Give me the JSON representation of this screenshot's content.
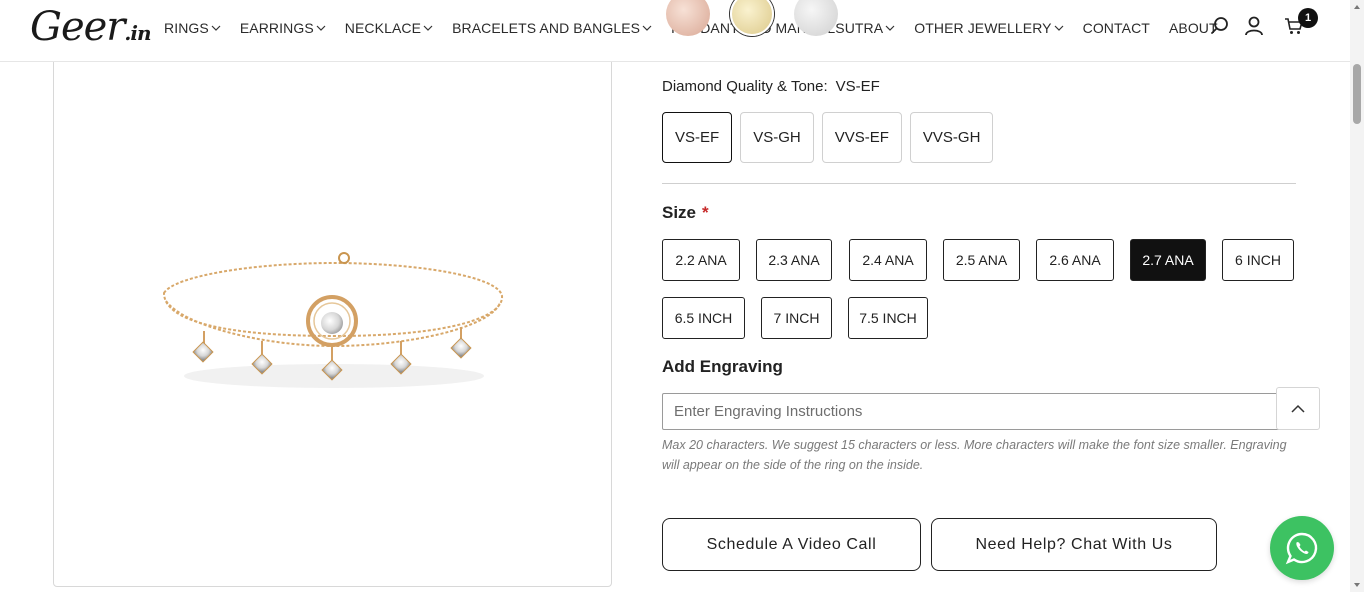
{
  "brand": {
    "logo_main": "Geer",
    "logo_tld": ".in"
  },
  "nav": {
    "items": [
      {
        "label": "RINGS",
        "dropdown": true
      },
      {
        "label": "EARRINGS",
        "dropdown": true
      },
      {
        "label": "NECKLACE",
        "dropdown": true
      },
      {
        "label": "BRACELETS AND BANGLES",
        "dropdown": true
      },
      {
        "label": "PENDANT AND MANGALSUTRA",
        "dropdown": true
      },
      {
        "label": "OTHER JEWELLERY",
        "dropdown": true
      },
      {
        "label": "CONTACT",
        "dropdown": false
      },
      {
        "label": "ABOUT",
        "dropdown": false
      }
    ],
    "icons": [
      "search-icon",
      "user-icon",
      "cart-icon"
    ],
    "cart_count": "1"
  },
  "metal_swatches": [
    "rose-gold",
    "yellow-gold",
    "white-gold"
  ],
  "quality": {
    "label": "Diamond Quality & Tone:",
    "selected": "VS-EF",
    "options": [
      "VS-EF",
      "VS-GH",
      "VVS-EF",
      "VVS-GH"
    ]
  },
  "size": {
    "label": "Size",
    "required_mark": "*",
    "options": [
      "2.2 ANA",
      "2.3 ANA",
      "2.4 ANA",
      "2.5 ANA",
      "2.6 ANA",
      "2.7 ANA",
      "6 INCH",
      "6.5 INCH",
      "7 INCH",
      "7.5 INCH"
    ],
    "selected": "2.7 ANA"
  },
  "engraving": {
    "label": "Add Engraving",
    "placeholder": "Enter Engraving Instructions",
    "note": "Max 20 characters. We suggest 15 characters or less. More characters will make the font size smaller. Engraving will appear on the side of the ring on the inside."
  },
  "actions": {
    "video_call": "Schedule A Video Call",
    "chat": "Need Help? Chat With Us"
  },
  "colors": {
    "accent": "#111111",
    "required": "#c62828",
    "whatsapp": "#3dc262"
  }
}
